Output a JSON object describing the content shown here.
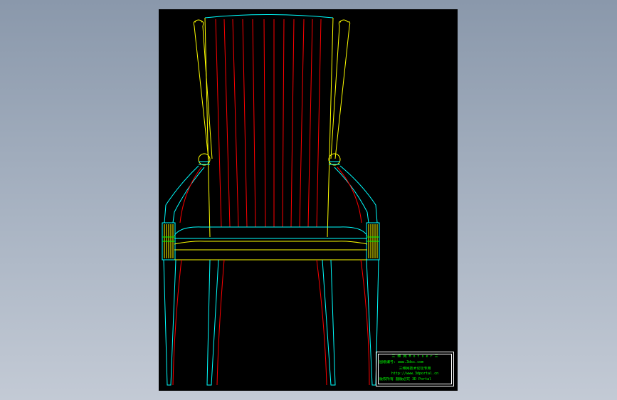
{
  "viewport": {
    "background": "gradient-gray-blue"
  },
  "sheet": {
    "background": "#000000"
  },
  "colors": {
    "red": "#ff0000",
    "yellow": "#ffff00",
    "cyan": "#00ffff",
    "green": "#00ff00",
    "white": "#ffffff"
  },
  "title_block": {
    "row1": "三 维 网   H o t s e r 三",
    "row2_left": "图纸编号:",
    "row2_right": "www.3dsc.com",
    "row3": "三维网技术论坛专用",
    "row4": "http://www.3dportal.cn",
    "row5": "版权所有 翻版必究 3D Portal"
  }
}
